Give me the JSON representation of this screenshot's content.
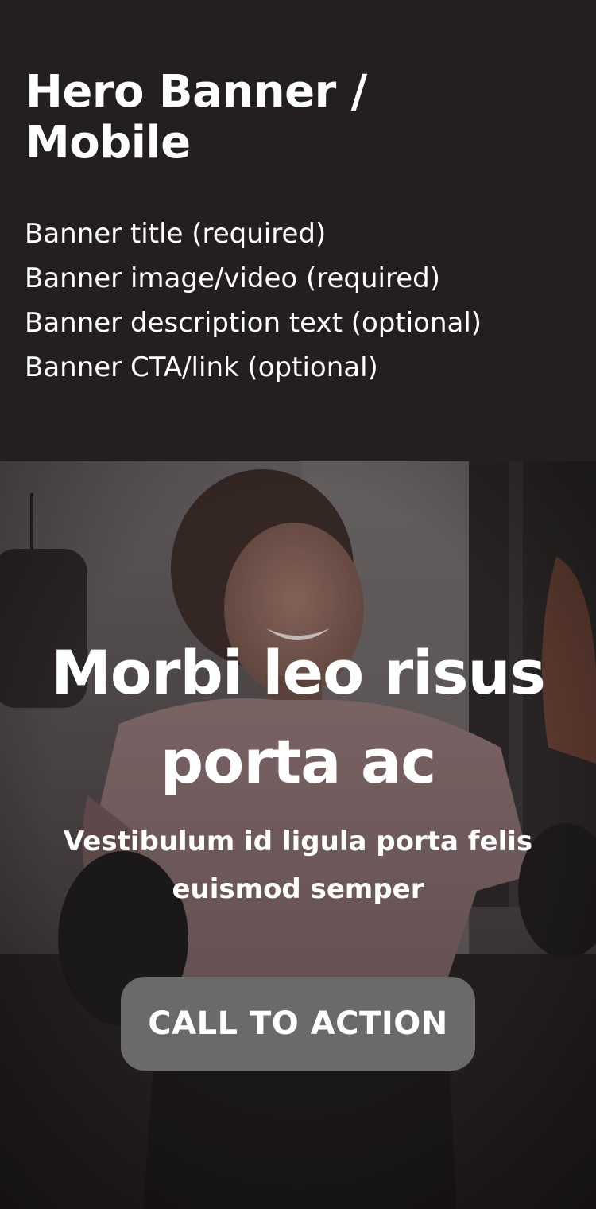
{
  "spec": {
    "title": "Hero Banner / Mobile",
    "fields": [
      "Banner title (required)",
      "Banner image/video (required)",
      "Banner description text (optional)",
      "Banner CTA/link (optional)"
    ]
  },
  "hero": {
    "title": "Morbi leo risus porta ac",
    "description": "Vestibulum id ligula porta felis euismod semper",
    "cta_label": "CALL TO ACTION",
    "image_subject": "woman smiling wearing boxing gloves in a gym"
  },
  "colors": {
    "page_background": "#231f20",
    "cta_background": "#6a6a6b",
    "text": "#ffffff"
  }
}
